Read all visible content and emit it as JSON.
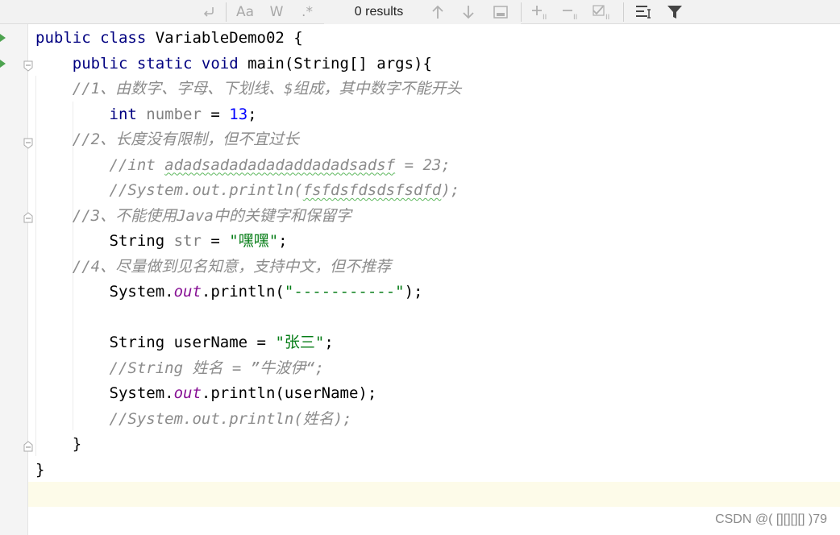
{
  "toolbar": {
    "match_case_label": "Aa",
    "words_label": "W",
    "regex_label": ".*",
    "results_label": "0 results",
    "icons": [
      "newline-icon",
      "arrow-up-icon",
      "arrow-down-icon",
      "select-all-occurrences-icon",
      "add-selection-icon",
      "remove-selection-icon",
      "select-all-matches-icon",
      "filter-settings-icon",
      "filter-icon"
    ]
  },
  "editor": {
    "lines": [
      [
        [
          "kw",
          "public class "
        ],
        [
          "",
          "VariableDemo02 {"
        ]
      ],
      [
        [
          "",
          "    "
        ],
        [
          "kw",
          "public static void "
        ],
        [
          "",
          "main(String[] args){"
        ]
      ],
      [
        [
          "",
          "    "
        ],
        [
          "cmt",
          "//1、由数字、字母、下划线、$组成，其中数字不能开头"
        ]
      ],
      [
        [
          "",
          "        "
        ],
        [
          "kw",
          "int "
        ],
        [
          "var",
          "number"
        ],
        [
          "",
          " = "
        ],
        [
          "num",
          "13"
        ],
        [
          "",
          ";"
        ]
      ],
      [
        [
          "",
          "    "
        ],
        [
          "cmt",
          "//2、长度没有限制，但不宜过长"
        ]
      ],
      [
        [
          "",
          "        "
        ],
        [
          "cmt",
          "//int "
        ],
        [
          "cmt typo",
          "adadsadadadadaddadadsadsf"
        ],
        [
          "cmt",
          " = 23;"
        ]
      ],
      [
        [
          "",
          "        "
        ],
        [
          "cmt",
          "//System.out.println("
        ],
        [
          "cmt typo",
          "fsfdsfdsdsfsdfd"
        ],
        [
          "cmt",
          ");"
        ]
      ],
      [
        [
          "",
          "    "
        ],
        [
          "cmt",
          "//3、不能使用Java中的关键字和保留字"
        ]
      ],
      [
        [
          "",
          "        String "
        ],
        [
          "var",
          "str"
        ],
        [
          "",
          " = "
        ],
        [
          "str",
          "\"嘿嘿\""
        ],
        [
          "",
          ";"
        ]
      ],
      [
        [
          "",
          "    "
        ],
        [
          "cmt",
          "//4、尽量做到见名知意，支持中文，但不推荐"
        ]
      ],
      [
        [
          "",
          "        System."
        ],
        [
          "field",
          "out"
        ],
        [
          "",
          ".println("
        ],
        [
          "str",
          "\"-----------\""
        ],
        [
          "",
          ");"
        ]
      ],
      [
        [
          "",
          ""
        ]
      ],
      [
        [
          "",
          "        String "
        ],
        [
          "",
          "userName"
        ],
        [
          "",
          " = "
        ],
        [
          "str",
          "\"张三\""
        ],
        [
          "",
          ";"
        ]
      ],
      [
        [
          "",
          "        "
        ],
        [
          "cmt",
          "//String 姓名 = ”牛波伊“;"
        ]
      ],
      [
        [
          "",
          "        System."
        ],
        [
          "field",
          "out"
        ],
        [
          "",
          ".println(userName);"
        ]
      ],
      [
        [
          "",
          "        "
        ],
        [
          "cmt",
          "//System.out.println(姓名);"
        ]
      ],
      [
        [
          "",
          "    }"
        ]
      ],
      [
        [
          "",
          "}"
        ]
      ]
    ]
  },
  "watermark": "CSDN @(   [][][][] )79"
}
